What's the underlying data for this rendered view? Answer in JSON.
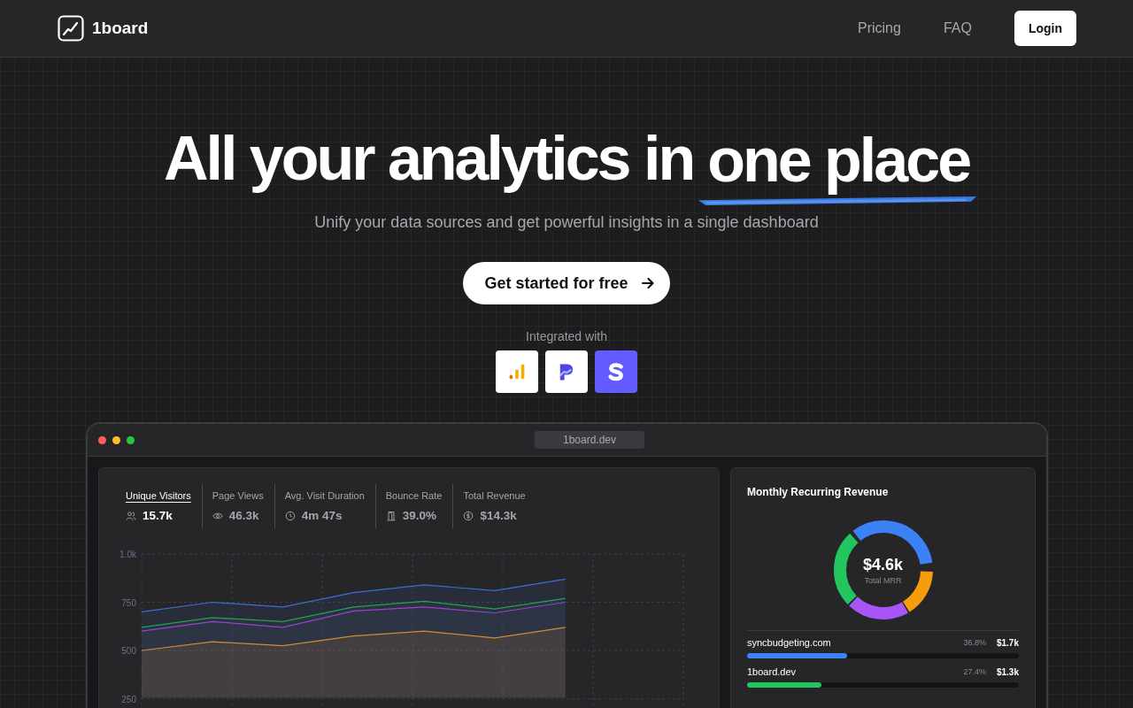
{
  "nav": {
    "brand": "1board",
    "links": [
      "Pricing",
      "FAQ"
    ],
    "login": "Login"
  },
  "hero": {
    "title_lead": "All your analytics in",
    "title_highlight": "one place",
    "subtitle": "Unify your data sources and get powerful insights in a single dashboard",
    "cta": "Get started for free",
    "integrated_label": "Integrated with"
  },
  "integrations": [
    {
      "kind": "analytics"
    },
    {
      "kind": "paddle"
    },
    {
      "kind": "stripe"
    }
  ],
  "browser": {
    "url": "1board.dev"
  },
  "stats": [
    {
      "label": "Unique Visitors",
      "value": "15.7k",
      "selected": true
    },
    {
      "label": "Page Views",
      "value": "46.3k",
      "selected": false
    },
    {
      "label": "Avg. Visit Duration",
      "value": "4m 47s",
      "selected": false
    },
    {
      "label": "Bounce Rate",
      "value": "39.0%",
      "selected": false
    },
    {
      "label": "Total Revenue",
      "value": "$14.3k",
      "selected": false
    }
  ],
  "chart_data": {
    "type": "area",
    "ylim": [
      250,
      1000
    ],
    "yticks": [
      250,
      500,
      750,
      {
        "value": 1000,
        "label": "1.0k"
      }
    ],
    "stacked": false,
    "series": [
      {
        "color": "#3b6fd4",
        "values": [
          700,
          750,
          725,
          800,
          840,
          810,
          870
        ]
      },
      {
        "color": "#22a35a",
        "values": [
          620,
          670,
          650,
          725,
          755,
          715,
          770
        ]
      },
      {
        "color": "#9b3fd6",
        "values": [
          600,
          650,
          620,
          705,
          725,
          695,
          750
        ]
      },
      {
        "color": "#d08a3a",
        "values": [
          500,
          545,
          525,
          575,
          600,
          565,
          620
        ]
      }
    ]
  },
  "mrr": {
    "title": "Monthly Recurring Revenue",
    "total": "$4.6k",
    "total_label": "Total MRR",
    "rows": [
      {
        "site": "syncbudgeting.com",
        "percent": "36.8%",
        "amount": "$1.7k",
        "level": 0.368,
        "color": "#3b82f6"
      },
      {
        "site": "1board.dev",
        "percent": "27.4%",
        "amount": "$1.3k",
        "level": 0.274,
        "color": "#22c55e"
      }
    ]
  }
}
